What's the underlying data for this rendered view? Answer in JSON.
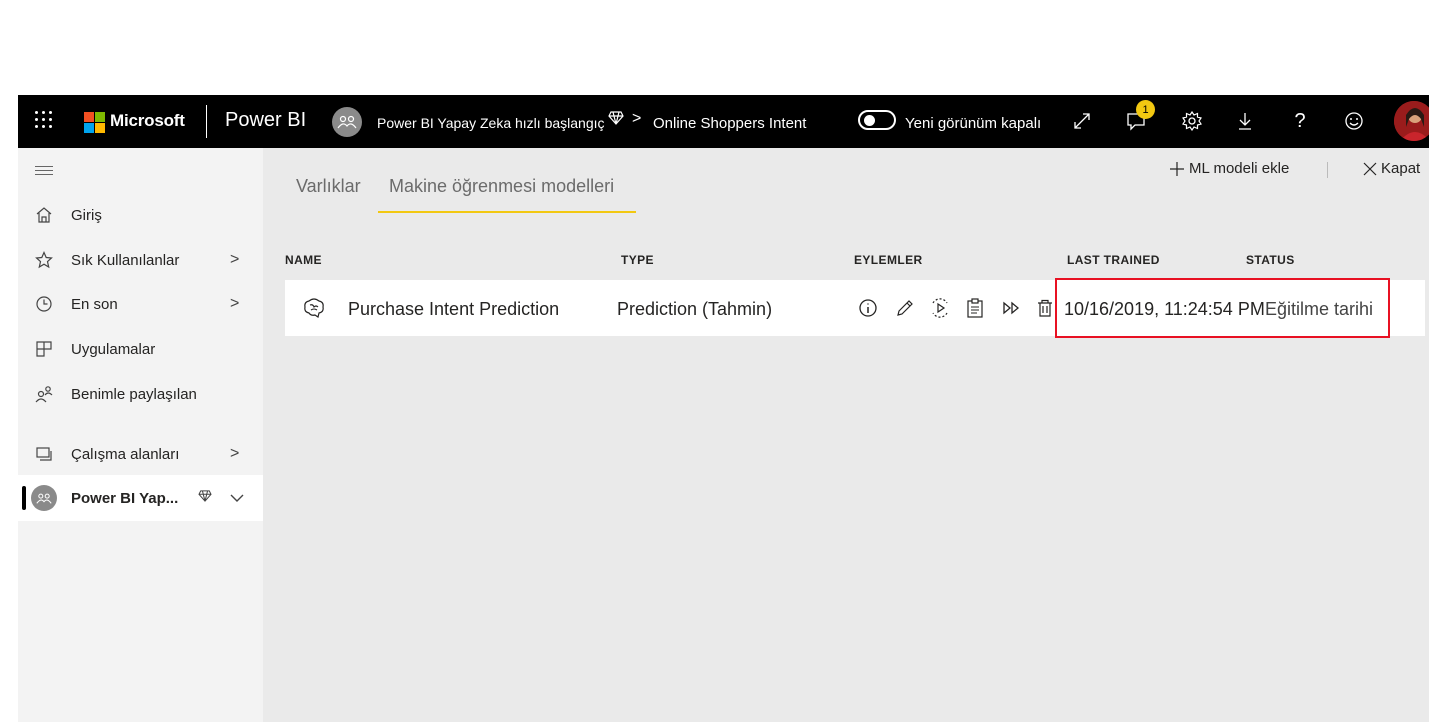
{
  "topbar": {
    "brand": "Microsoft",
    "product": "Power BI",
    "breadcrumb": {
      "workspace": "Power BI Yapay Zeka hızlı başlangıç",
      "separator": ">",
      "page": "Online Shoppers Intent"
    },
    "new_look_label": "Yeni görünüm kapalı",
    "notification_count": "1",
    "icons": [
      "app-launcher-icon",
      "expand-icon",
      "notifications-icon",
      "settings-icon",
      "download-icon",
      "help-icon",
      "feedback-icon"
    ]
  },
  "sidebar": {
    "items": [
      {
        "label": "Giriş",
        "icon": "home-icon"
      },
      {
        "label": "Sık Kullanılanlar",
        "icon": "star-icon",
        "chevron": ">"
      },
      {
        "label": "En son",
        "icon": "clock-icon",
        "chevron": ">"
      },
      {
        "label": "Uygulamalar",
        "icon": "apps-icon"
      },
      {
        "label": "Benimle paylaşılan",
        "icon": "shared-icon"
      },
      {
        "label": "Çalışma alanları",
        "icon": "workspaces-icon",
        "chevron": ">"
      },
      {
        "label": "Power BI Yap...",
        "icon": "workspace-avatar-icon",
        "chevron": "v"
      }
    ]
  },
  "main": {
    "tabs": [
      {
        "label": "Varlıklar"
      },
      {
        "label": "Makine öğrenmesi modelleri",
        "selected": true
      }
    ],
    "actions": {
      "add_model": "ML modeli ekle",
      "close": "Kapat"
    },
    "columns": [
      "NAME",
      "TYPE",
      "EYLEMLER",
      "LAST TRAINED",
      "STATUS"
    ],
    "rows": [
      {
        "name": "Purchase Intent Prediction",
        "type": "Prediction (Tahmin)",
        "actions": [
          "info-icon",
          "edit-icon",
          "apply-model-icon",
          "report-icon",
          "run-icon",
          "delete-icon"
        ],
        "last_trained": "10/16/2019, 11:24:54 PM",
        "status": "Eğitilme tarihi"
      }
    ]
  },
  "colors": {
    "topbar": "#000000",
    "accent": "#f2c811",
    "highlight": "#e81123",
    "background": "#eaeaea"
  }
}
